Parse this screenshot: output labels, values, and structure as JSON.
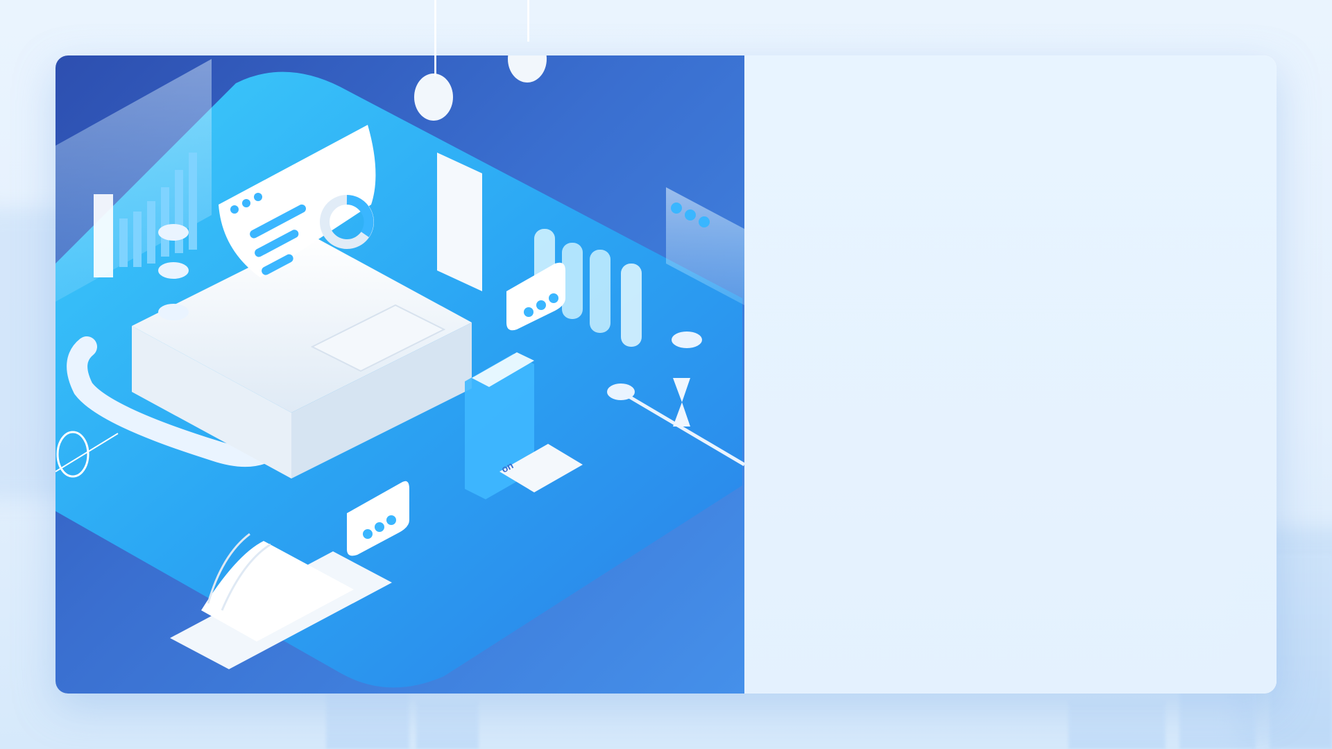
{
  "scene": {
    "background_color": "#e6f2fe",
    "card_color": "#eaf5ff",
    "illustration_gradient": [
      "#2d4fb0",
      "#4590ea"
    ],
    "accent_color": "#35c8ff",
    "illustration_label": "on",
    "icons": [
      "bar-chart-panel-icon",
      "laptop-icon",
      "document-icon",
      "donut-chart-icon",
      "keyboard-icon",
      "chat-bubble-icon",
      "phone-cards-icon",
      "hourglass-icon",
      "browser-window-icon",
      "open-book-icon",
      "hanging-tag-icon"
    ]
  }
}
